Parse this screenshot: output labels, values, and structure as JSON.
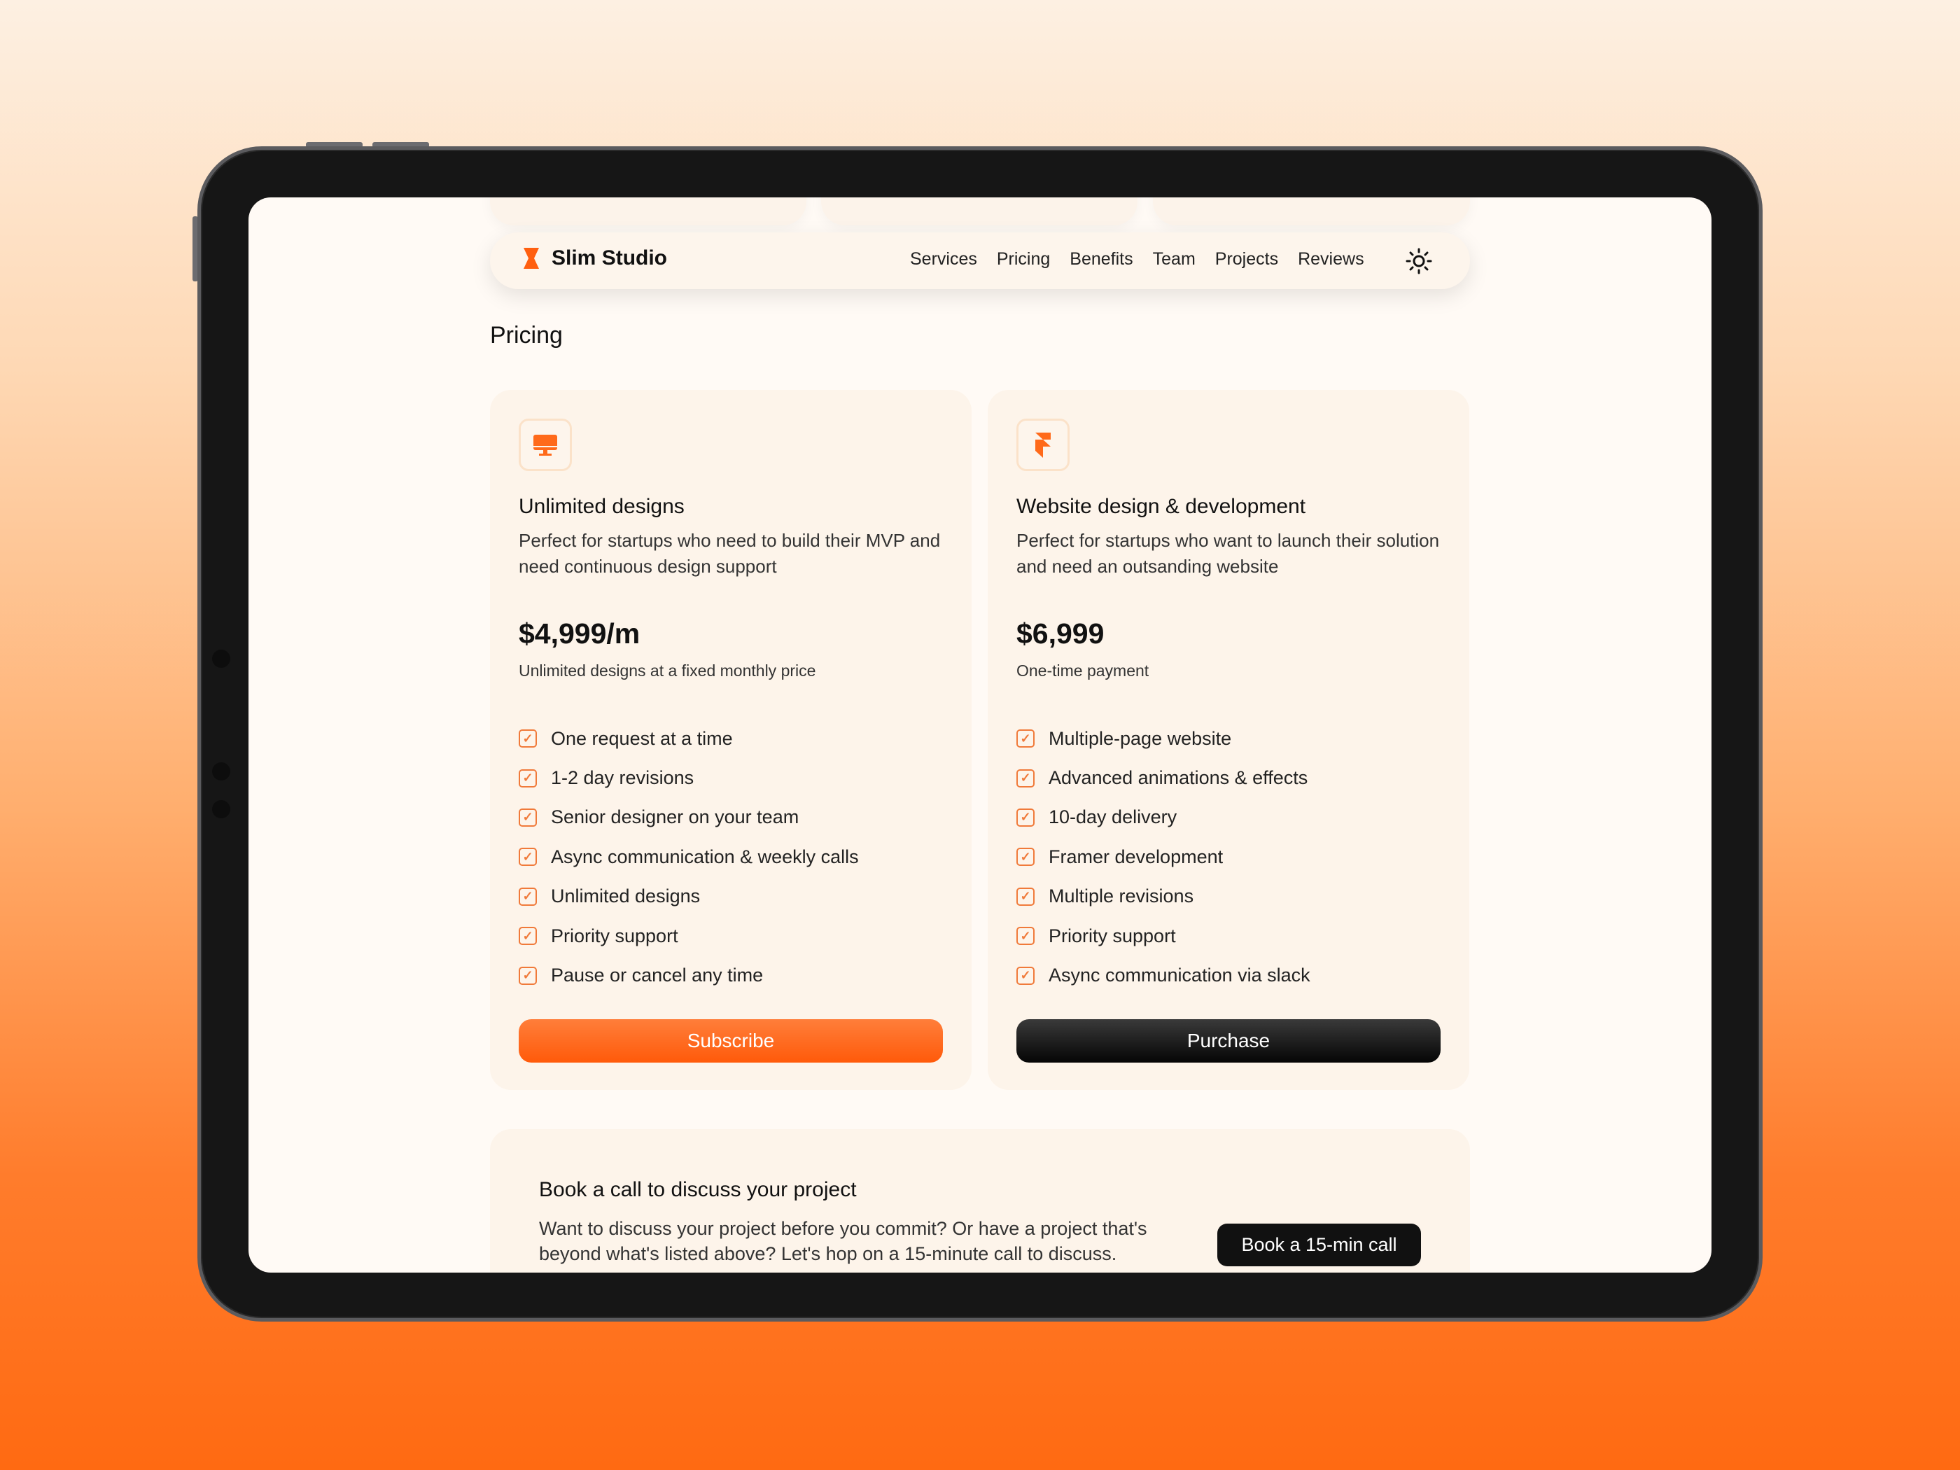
{
  "brand": {
    "name": "Slim Studio",
    "accent": "#ff5f0f"
  },
  "nav": {
    "links": [
      "Services",
      "Pricing",
      "Benefits",
      "Team",
      "Projects",
      "Reviews"
    ],
    "theme_icon": "sun-icon"
  },
  "page_title": "Pricing",
  "plans": [
    {
      "icon": "monitor-icon",
      "title": "Unlimited designs",
      "description": "Perfect for startups who need to build their MVP and need continuous design support",
      "price": "$4,999/m",
      "price_note": "Unlimited designs at a fixed monthly price",
      "features": [
        "One request at a time",
        "1-2 day revisions",
        "Senior designer on your team",
        "Async communication & weekly calls",
        "Unlimited designs",
        "Priority support",
        "Pause or cancel any time"
      ],
      "cta": "Subscribe"
    },
    {
      "icon": "framer-icon",
      "title": "Website design & development",
      "description": "Perfect for startups who want to launch their solution and need an outsanding website",
      "price": "$6,999",
      "price_note": "One-time payment",
      "features": [
        "Multiple-page website",
        "Advanced animations & effects",
        "10-day delivery",
        "Framer development",
        "Multiple revisions",
        "Priority support",
        "Async communication via slack"
      ],
      "cta": "Purchase"
    }
  ],
  "call": {
    "title": "Book a call to discuss your project",
    "text": "Want to discuss your project before you commit? Or have a project that's beyond what's listed above? Let's hop on a 15-minute call to discuss.",
    "cta": "Book a 15-min call"
  }
}
